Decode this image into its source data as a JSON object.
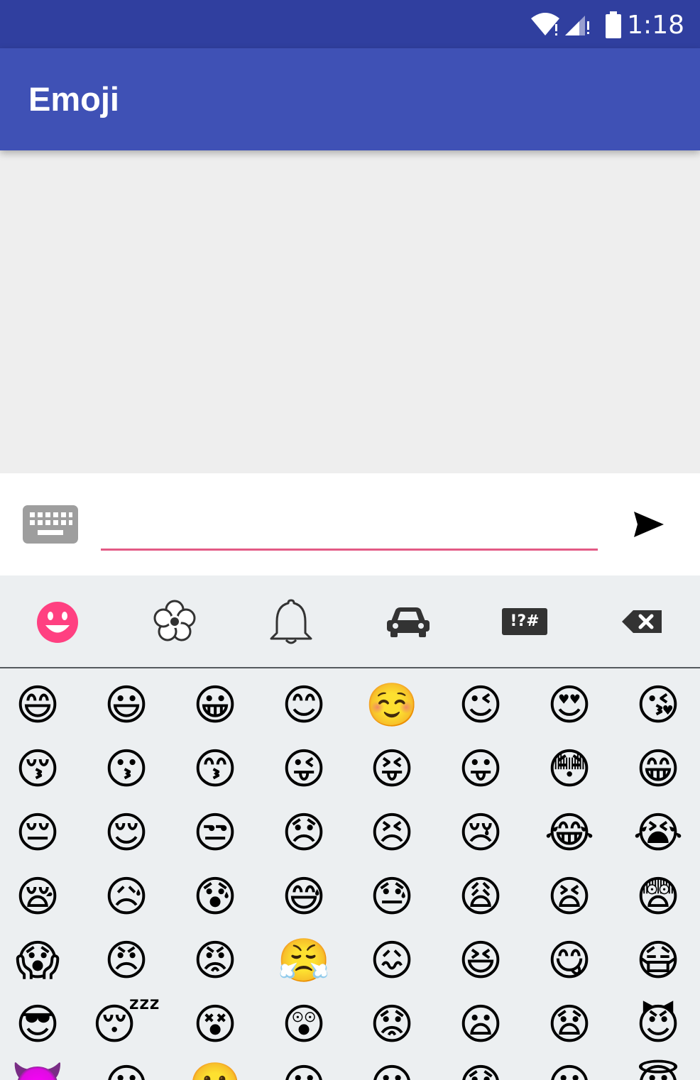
{
  "status_bar": {
    "time": "1:18"
  },
  "app_bar": {
    "title": "Emoji"
  },
  "input": {
    "value": "",
    "placeholder": ""
  },
  "categories": [
    {
      "name": "smileys",
      "icon": "smiley-icon",
      "active": true
    },
    {
      "name": "nature",
      "icon": "flower-icon",
      "active": false
    },
    {
      "name": "objects",
      "icon": "bell-icon",
      "active": false
    },
    {
      "name": "places",
      "icon": "car-icon",
      "active": false
    },
    {
      "name": "symbols",
      "icon": "symbols-icon",
      "label": "!?#",
      "active": false
    },
    {
      "name": "delete",
      "icon": "backspace-icon",
      "active": false
    }
  ],
  "colors": {
    "status_bar": "#303f9f",
    "app_bar": "#3f51b5",
    "accent": "#ff4081",
    "underline": "#e35a85",
    "panel": "#eceff1"
  },
  "emoji_rows": [
    [
      "😄",
      "😃",
      "😀",
      "😊",
      "☺️",
      "😉",
      "😍",
      "😘"
    ],
    [
      "😚",
      "😗",
      "😙",
      "😜",
      "😝",
      "😛",
      "😳",
      "😁"
    ],
    [
      "😔",
      "😌",
      "😒",
      "😞",
      "😣",
      "😢",
      "😂",
      "😭"
    ],
    [
      "😪",
      "😥",
      "😰",
      "😅",
      "😓",
      "😩",
      "😫",
      "😨"
    ],
    [
      "😱",
      "😠",
      "😡",
      "😤",
      "😖",
      "😆",
      "😋",
      "😷"
    ],
    [
      "😎",
      "😴",
      "😵",
      "😲",
      "😟",
      "😦",
      "😧",
      "😈"
    ],
    [
      "👿",
      "😮",
      "😬",
      "😐",
      "😕",
      "😯",
      "😶",
      "😇"
    ]
  ]
}
